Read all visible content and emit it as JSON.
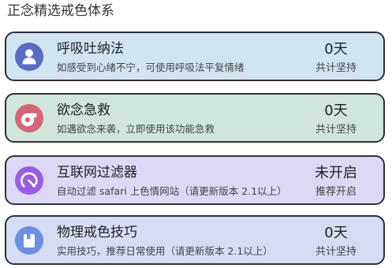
{
  "header": {
    "title": "正念精选戒色体系"
  },
  "cards": [
    {
      "title": "呼吸吐纳法",
      "subtitle": "如感受到心绪不宁，可使用呼吸法平复情绪",
      "stat_value": "0天",
      "stat_label": "共计坚持",
      "icon": "person-icon",
      "bg_color": "#d1e5f1",
      "icon_color": "#5a6bc4"
    },
    {
      "title": "欲念急救",
      "subtitle": "如遇欲念来袭，立即使用该功能急救",
      "stat_value": "0天",
      "stat_label": "共计坚持",
      "icon": "whistle-icon",
      "bg_color": "#d0e6dc",
      "icon_color": "#d46679"
    },
    {
      "title": "互联网过滤器",
      "subtitle": "自动过滤 safari 上色情网站（请更新版本 2.1以上）",
      "stat_value": "未开启",
      "stat_label": "推荐开启",
      "icon": "gauge-icon",
      "bg_color": "#dcd8f5",
      "icon_color": "#985ee2"
    },
    {
      "title": "物理戒色技巧",
      "subtitle": "实用技巧，推荐日常使用（请更新版本 2.1以上）",
      "stat_value": "0天",
      "stat_label": "共计坚持",
      "icon": "bookmark-icon",
      "bg_color": "#d6dcf4",
      "icon_color": "#6d8fe0"
    }
  ]
}
